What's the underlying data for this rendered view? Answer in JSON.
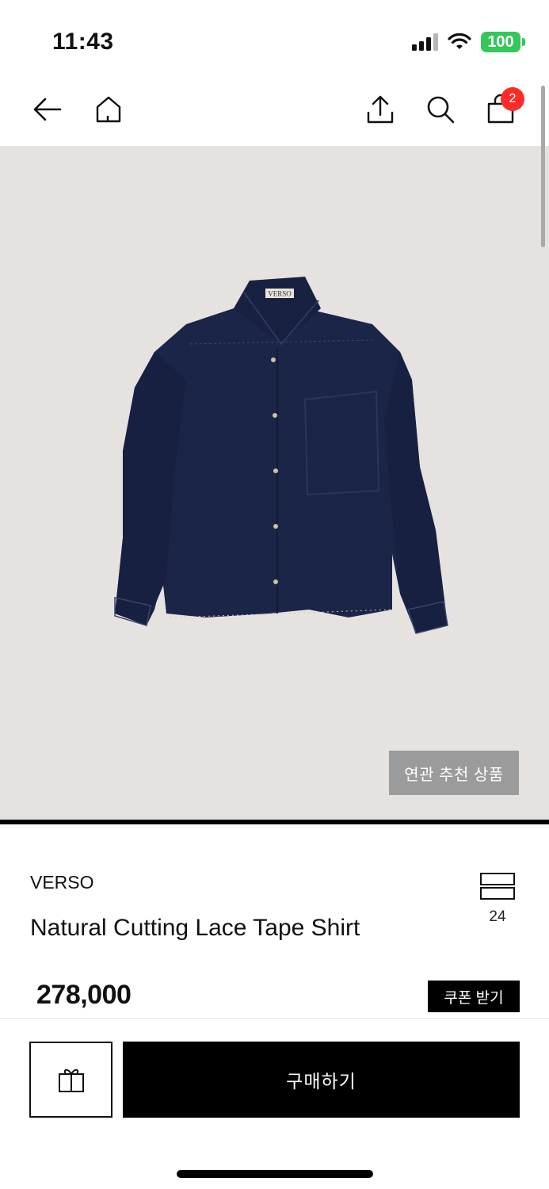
{
  "status_bar": {
    "time": "11:43",
    "battery": "100",
    "icons": [
      "signal-icon",
      "wifi-icon",
      "battery-icon"
    ]
  },
  "nav": {
    "icons": [
      "back-arrow-icon",
      "home-icon",
      "share-icon",
      "search-icon",
      "shopping-bag-icon"
    ],
    "cart_count": "2"
  },
  "product": {
    "image_description_icon": "navy-shirt-image",
    "label_text": "VERSO",
    "related_button": "연관 추천 상품",
    "brand": "VERSO",
    "name": "Natural Cutting Lace Tape Shirt",
    "compare_count": "24",
    "price": "278,000",
    "coupon_button": "쿠폰 받기"
  },
  "bottom_bar": {
    "gift_icon": "gift-icon",
    "buy_button": "구매하기"
  },
  "colors": {
    "image_background": "#e6e2df",
    "shirt": "#1b2548",
    "badge": "#ff2b2b",
    "battery": "#34c759",
    "buy_button": "#000000",
    "related_button": "#9b9b9b"
  }
}
